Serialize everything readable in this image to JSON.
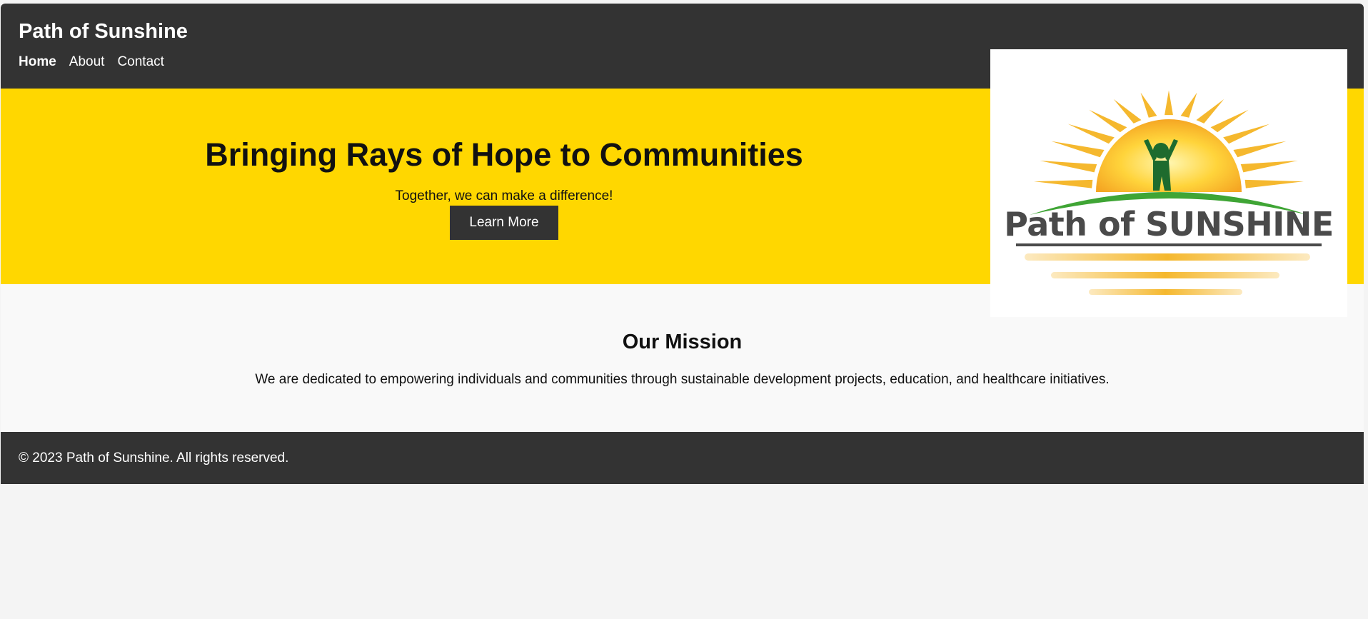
{
  "header": {
    "site_title": "Path of Sunshine",
    "nav": [
      {
        "label": "Home",
        "active": true
      },
      {
        "label": "About",
        "active": false
      },
      {
        "label": "Contact",
        "active": false
      }
    ]
  },
  "hero": {
    "title": "Bringing Rays of Hope to Communities",
    "subtitle": "Together, we can make a difference!",
    "cta_label": "Learn More"
  },
  "mission": {
    "title": "Our Mission",
    "text": "We are dedicated to empowering individuals and communities through sustainable development projects, education, and healthcare initiatives."
  },
  "footer": {
    "text": "© 2023 Path of Sunshine. All rights reserved."
  },
  "logo": {
    "text": "Path of SUNSHINE",
    "icon": "sun-person-icon"
  },
  "colors": {
    "header_bg": "#333333",
    "hero_bg": "#ffd700",
    "mission_bg": "#f9f9f9",
    "page_bg": "#f4f4f4",
    "sun": "#f5b82e",
    "figure": "#1e6b2e",
    "hill": "#3fa535"
  }
}
